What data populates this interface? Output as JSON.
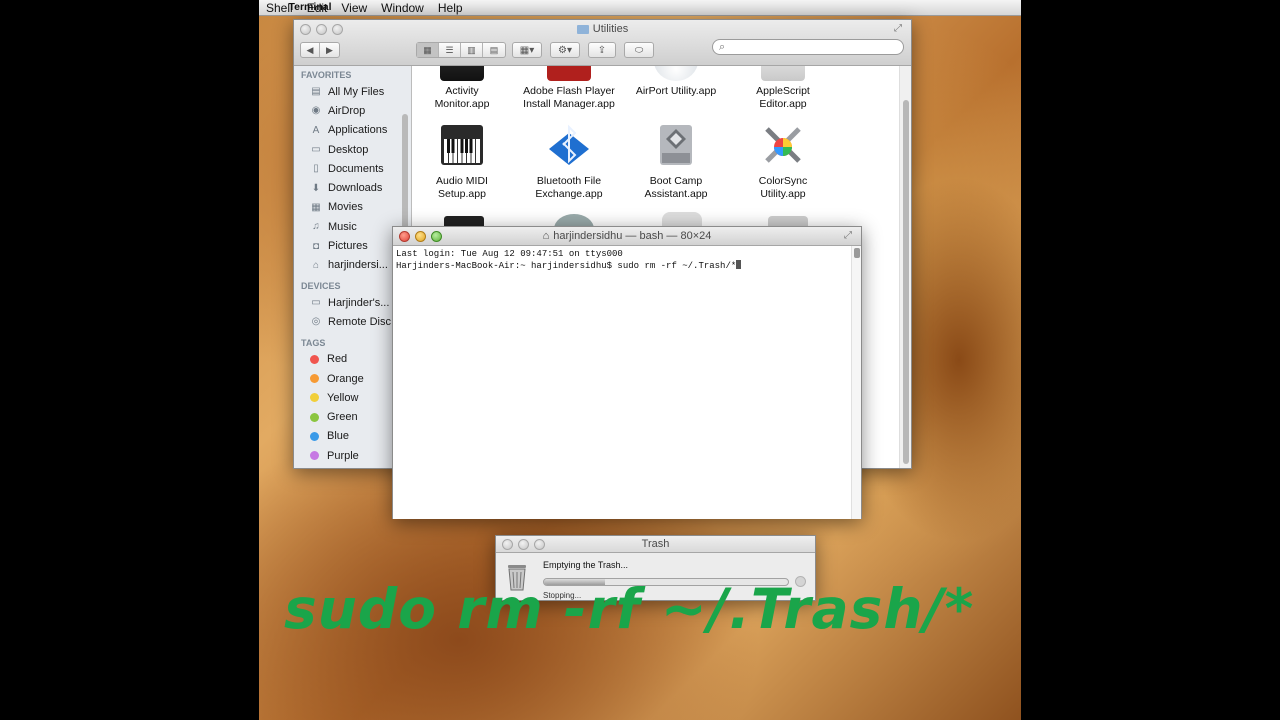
{
  "menubar": {
    "app": "Terminal",
    "items": [
      "Shell",
      "Edit",
      "View",
      "Window",
      "Help"
    ]
  },
  "finder": {
    "title": "Utilities",
    "sidebar": {
      "favorites_heading": "FAVORITES",
      "favorites": [
        "All My Files",
        "AirDrop",
        "Applications",
        "Desktop",
        "Documents",
        "Downloads",
        "Movies",
        "Music",
        "Pictures",
        "harjindersi..."
      ],
      "devices_heading": "DEVICES",
      "devices": [
        "Harjinder's...",
        "Remote Disc"
      ],
      "tags_heading": "TAGS",
      "tags": [
        {
          "label": "Red",
          "color": "#f0554f"
        },
        {
          "label": "Orange",
          "color": "#f69a34"
        },
        {
          "label": "Yellow",
          "color": "#f1cf3a"
        },
        {
          "label": "Green",
          "color": "#8bc53f"
        },
        {
          "label": "Blue",
          "color": "#3a9ae8"
        },
        {
          "label": "Purple",
          "color": "#c679e3"
        }
      ]
    },
    "apps": [
      {
        "line1": "Activity",
        "line2": "Monitor.app",
        "icon": "activity-monitor-icon"
      },
      {
        "line1": "Adobe Flash Player",
        "line2": "Install Manager.app",
        "icon": "flash-player-icon"
      },
      {
        "line1": "AirPort Utility.app",
        "line2": "",
        "icon": "airport-utility-icon"
      },
      {
        "line1": "AppleScript",
        "line2": "Editor.app",
        "icon": "applescript-icon"
      },
      {
        "line1": "Audio MIDI",
        "line2": "Setup.app",
        "icon": "piano-icon"
      },
      {
        "line1": "Bluetooth File",
        "line2": "Exchange.app",
        "icon": "bluetooth-icon"
      },
      {
        "line1": "Boot Camp",
        "line2": "Assistant.app",
        "icon": "boot-camp-icon"
      },
      {
        "line1": "ColorSync",
        "line2": "Utility.app",
        "icon": "colorsync-icon"
      }
    ]
  },
  "terminal": {
    "title": "harjindersidhu — bash — 80×24",
    "line1": "Last login: Tue Aug 12 09:47:51 on ttys000",
    "line2": "Harjinders-MacBook-Air:~ harjindersidhu$ sudo rm -rf ~/.Trash/*"
  },
  "trash": {
    "title": "Trash",
    "message": "Emptying the Trash...",
    "status": "Stopping...",
    "progress": 0.25
  },
  "overlay": {
    "text": "sudo rm -rf ~/.Trash/*",
    "color": "#1aa54a"
  }
}
